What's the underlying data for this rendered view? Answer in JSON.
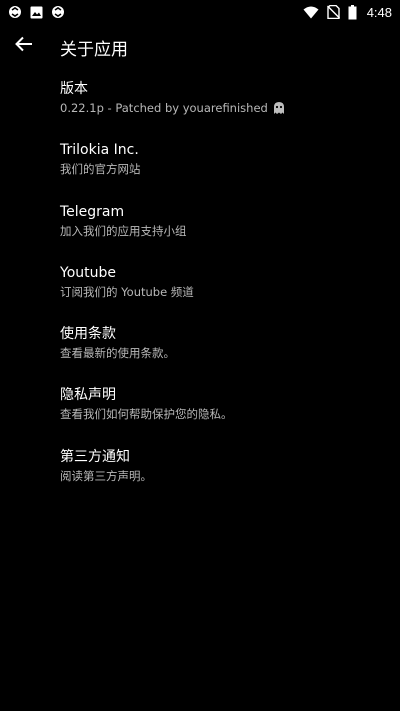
{
  "status_bar": {
    "time": "4:48",
    "left_icons": [
      "sync-icon",
      "image-icon",
      "sync-icon"
    ],
    "right_icons": [
      "wifi-icon",
      "sim-off-icon",
      "battery-icon"
    ]
  },
  "toolbar": {
    "back_icon": "arrow-back-icon",
    "title": "关于应用"
  },
  "items": [
    {
      "title": "版本",
      "subtitle": "0.22.1p - Patched by youarefinished",
      "subtitle_icon": "ghost-icon"
    },
    {
      "title": "Trilokia Inc.",
      "subtitle": "我们的官方网站"
    },
    {
      "title": "Telegram",
      "subtitle": "加入我们的应用支持小组"
    },
    {
      "title": "Youtube",
      "subtitle": "订阅我们的 Youtube 频道"
    },
    {
      "title": "使用条款",
      "subtitle": "查看最新的使用条款。"
    },
    {
      "title": "隐私声明",
      "subtitle": "查看我们如何帮助保护您的隐私。"
    },
    {
      "title": "第三方通知",
      "subtitle": "阅读第三方声明。"
    }
  ],
  "colors": {
    "background": "#000000",
    "title_text": "#ffffff",
    "subtitle_text": "#b8b8b8"
  }
}
